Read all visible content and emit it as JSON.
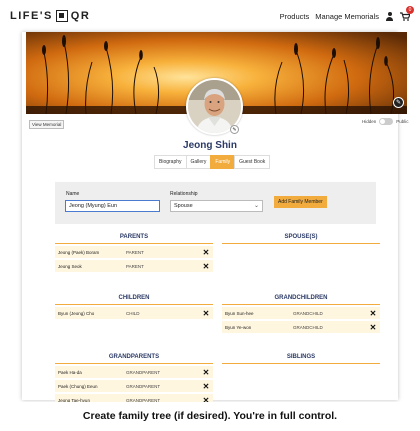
{
  "header": {
    "logo_left": "LIFE'S",
    "logo_right": "QR",
    "nav": {
      "products": "Products",
      "manage": "Manage Memorials"
    },
    "cart_count": "0"
  },
  "profile": {
    "view_memorial": "View Memorial",
    "toggle_hidden": "Hidden",
    "toggle_public": "Public",
    "name": "Jeong Shin",
    "tabs": [
      {
        "label": "Biography",
        "active": false
      },
      {
        "label": "Gallery",
        "active": false
      },
      {
        "label": "Family",
        "active": true
      },
      {
        "label": "Guest Book",
        "active": false
      }
    ]
  },
  "form": {
    "name_label": "Name",
    "name_value": "Jeong (Myung) Eun",
    "relationship_label": "Relationship",
    "relationship_value": "Spouse",
    "add_button": "Add Family Member"
  },
  "sections": {
    "parents": {
      "title": "PARENTS",
      "rows": [
        {
          "name": "Jeong (Paek) Boram",
          "relation": "PARENT"
        },
        {
          "name": "Jeong Seok",
          "relation": "PARENT"
        }
      ]
    },
    "spouses": {
      "title": "SPOUSE(S)",
      "rows": []
    },
    "children": {
      "title": "CHILDREN",
      "rows": [
        {
          "name": "Byun (Jeong) Cho",
          "relation": "CHILD"
        }
      ]
    },
    "grandchildren": {
      "title": "GRANDCHILDREN",
      "rows": [
        {
          "name": "Byun Sun-hee",
          "relation": "GRANDCHILD"
        },
        {
          "name": "Byun Ye-won",
          "relation": "GRANDCHILD"
        }
      ]
    },
    "grandparents": {
      "title": "GRANDPARENTS",
      "rows": [
        {
          "name": "Paek Ha-da",
          "relation": "GRANDPARENT"
        },
        {
          "name": "Paek (Chung) Eeun",
          "relation": "GRANDPARENT"
        },
        {
          "name": "Jeong Tae-hyun",
          "relation": "GRANDPARENT"
        }
      ]
    },
    "siblings": {
      "title": "SIBLINGS",
      "rows": []
    }
  },
  "caption": "Create family tree (if desired). You're in full control.",
  "colors": {
    "accent": "#f2ac3e",
    "navy": "#2b3a66",
    "row_bg": "#fff6df",
    "badge": "#d9322d"
  },
  "icons": [
    "user-icon",
    "cart-icon",
    "edit-pencil-icon",
    "remove-x-icon",
    "chevron-down-icon"
  ]
}
